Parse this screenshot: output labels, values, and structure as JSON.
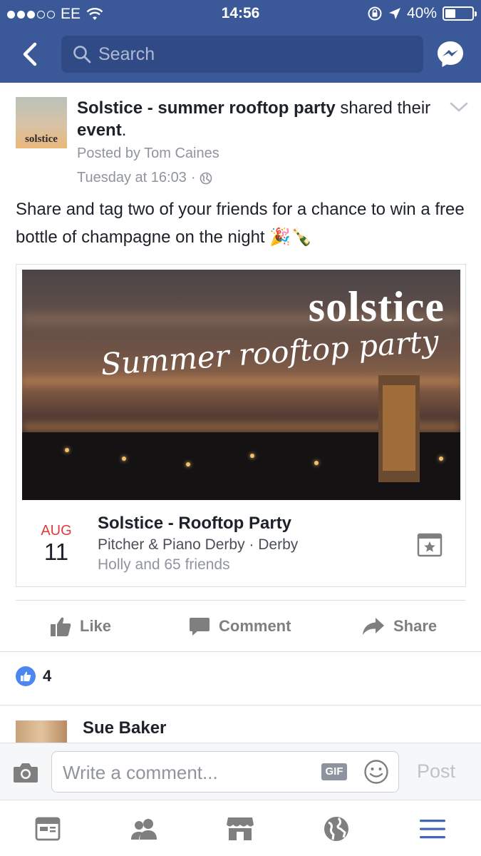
{
  "status_bar": {
    "carrier": "EE",
    "time": "14:56",
    "battery": "40%",
    "battery_level": 0.4
  },
  "header": {
    "search_placeholder": "Search",
    "icons": [
      "back-icon",
      "search-icon",
      "messenger-icon"
    ]
  },
  "post": {
    "page_name": "Solstice - summer rooftop party",
    "shared_text": "shared their",
    "event_word": "event",
    "period": ".",
    "avatar_text": "solstice",
    "posted_by": "Posted by Tom Caines",
    "timestamp": "Tuesday at 16:03",
    "separator": "·",
    "body": "Share and tag two of your friends for a chance to win a free bottle of champagne on the night 🎉🍾"
  },
  "event": {
    "cover_title": "solstice",
    "cover_subtitle": "Summer rooftop party",
    "month": "AUG",
    "day": "11",
    "title": "Solstice - Rooftop Party",
    "venue": "Pitcher & Piano Derby · Derby",
    "friends": "Holly and 65 friends"
  },
  "actions": {
    "like": "Like",
    "comment": "Comment",
    "share": "Share"
  },
  "reactions": {
    "count": "4"
  },
  "comment": {
    "author": "Sue Baker"
  },
  "composer": {
    "placeholder": "Write a comment...",
    "gif": "GIF",
    "post": "Post"
  },
  "tabbar": {
    "tabs": [
      "news-feed-icon",
      "friends-icon",
      "marketplace-icon",
      "notifications-globe-icon",
      "menu-icon"
    ],
    "active_color": "#4267b2"
  },
  "colors": {
    "brand_blue": "#3b5998",
    "date_red": "#e03b3b",
    "muted_text": "#90949c"
  }
}
